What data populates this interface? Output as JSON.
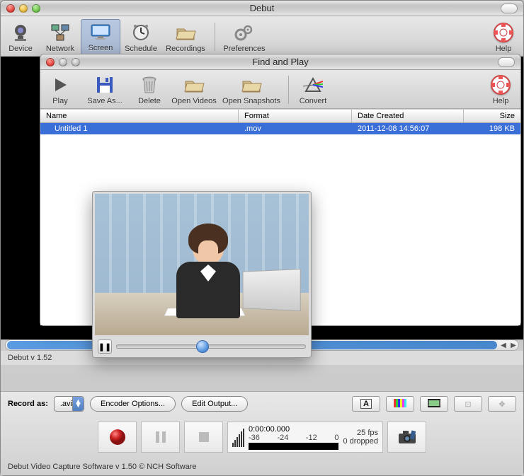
{
  "main": {
    "title": "Debut",
    "toolbar": [
      {
        "id": "device",
        "label": "Device"
      },
      {
        "id": "network",
        "label": "Network"
      },
      {
        "id": "screen",
        "label": "Screen"
      },
      {
        "id": "schedule",
        "label": "Schedule"
      },
      {
        "id": "recordings",
        "label": "Recordings"
      },
      {
        "id": "preferences",
        "label": "Preferences"
      }
    ],
    "help_label": "Help",
    "version_short": "Debut v 1.52",
    "record_as_label": "Record as:",
    "format_selected": ".avi",
    "encoder_btn": "Encoder Options...",
    "edit_output_btn": "Edit Output...",
    "meter": {
      "time": "0:00:00.000",
      "scale": [
        "-36",
        "-24",
        "-12",
        "0"
      ],
      "fps": "25 fps",
      "dropped": "0 dropped"
    },
    "footer": "Debut Video Capture Software v 1.50 © NCH Software"
  },
  "sub": {
    "title": "Find and Play",
    "toolbar": [
      {
        "id": "play",
        "label": "Play"
      },
      {
        "id": "saveas",
        "label": "Save As..."
      },
      {
        "id": "delete",
        "label": "Delete"
      },
      {
        "id": "openvideos",
        "label": "Open Videos"
      },
      {
        "id": "opensnapshots",
        "label": "Open Snapshots"
      },
      {
        "id": "convert",
        "label": "Convert"
      }
    ],
    "help_label": "Help",
    "columns": {
      "name": "Name",
      "format": "Format",
      "date": "Date Created",
      "size": "Size"
    },
    "rows": [
      {
        "name": "Untitled 1",
        "format": ".mov",
        "date": "2011-12-08 14:56:07",
        "size": "198 KB"
      }
    ]
  }
}
